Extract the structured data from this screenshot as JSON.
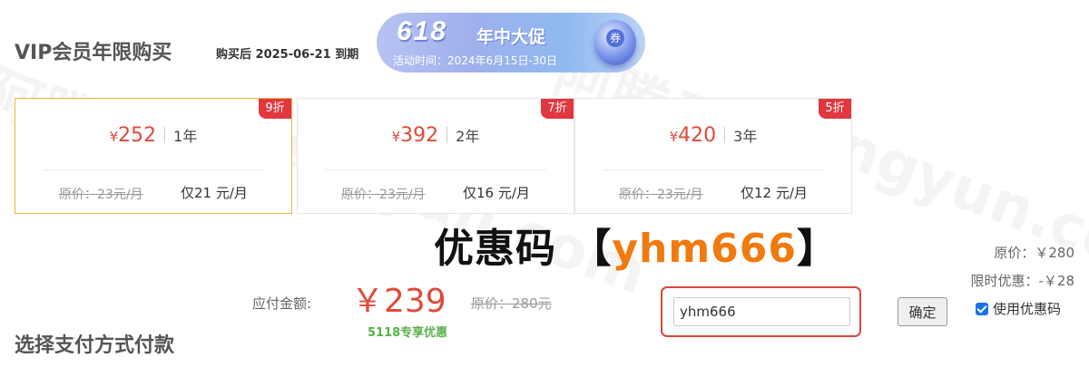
{
  "header": {
    "title": "VIP会员年限购买",
    "expire_note": "购买后 2025-06-21 到期"
  },
  "promo": {
    "big_text": "618",
    "sub_text": "年中大促",
    "period": "活动时间：2024年6月15日-30日"
  },
  "plans": [
    {
      "currency": "¥",
      "price": "252",
      "term": "1年",
      "original": "原价：23元/月",
      "monthly": "仅21 元/月",
      "discount": "9折",
      "selected": true
    },
    {
      "currency": "¥",
      "price": "392",
      "term": "2年",
      "original": "原价：23元/月",
      "monthly": "仅16 元/月",
      "discount": "7折",
      "selected": false
    },
    {
      "currency": "¥",
      "price": "420",
      "term": "3年",
      "original": "原价：23元/月",
      "monthly": "仅12 元/月",
      "discount": "5折",
      "selected": false
    }
  ],
  "coupon_banner": {
    "label": "优惠码",
    "open": "【",
    "code": "yhm666",
    "close": "】"
  },
  "summary": {
    "original": "原价：￥280",
    "limited": "限时优惠：-￥28"
  },
  "payment": {
    "label": "应付金额:",
    "amount": "￥239",
    "original": "原价：280元",
    "tag": "5118专享优惠"
  },
  "coupon": {
    "value": "yhm666",
    "confirm_label": "确定",
    "use_label": "使用优惠码",
    "use_checked": true
  },
  "pay_section": {
    "title": "选择支付方式付款"
  },
  "watermark": {
    "text_cn": "阿腾云",
    "text_en": "atengyun.com"
  },
  "colors": {
    "price_red": "#e04a3a",
    "selected_border": "#f0b63c",
    "discount_badge": "#e0383e",
    "coupon_code_orange": "#f07a10",
    "tag_green": "#5ab04b",
    "checkbox_blue": "#1a73e8"
  }
}
